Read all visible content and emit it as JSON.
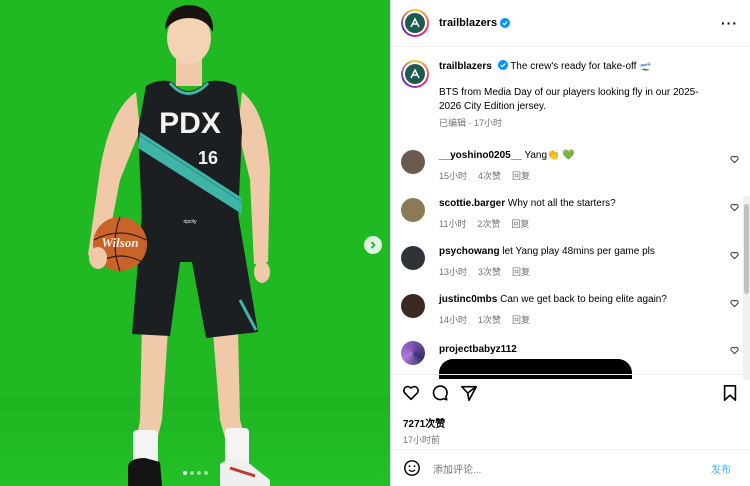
{
  "post": {
    "username": "trailblazers",
    "header_icon": "more-horizontal-icon"
  },
  "caption": {
    "username": "trailblazers",
    "title": "The crew's ready for take-off 🛫",
    "text": "BTS from Media Day of our players looking fly in our 2025-2026 City Edition jersey.",
    "edited": "已编辑",
    "time": "17小时"
  },
  "comments": [
    {
      "username": "__yoshino0205__",
      "text": "Yang👏 💚",
      "time": "15小时",
      "likes": "4次赞",
      "reply": "回复",
      "avatar_color": "#6b5a4e"
    },
    {
      "username": "scottie.barger",
      "text": "Why not all the starters?",
      "time": "11小时",
      "likes": "2次赞",
      "reply": "回复",
      "avatar_color": "#8a7a55"
    },
    {
      "username": "psychowang",
      "text": "let Yang play 48mins per game pls",
      "time": "13小时",
      "likes": "3次赞",
      "reply": "回复",
      "avatar_color": "#2f3338"
    },
    {
      "username": "justinc0mbs",
      "text": "Can we get back to being elite again?",
      "time": "14小时",
      "likes": "1次赞",
      "reply": "回复",
      "avatar_color": "#3a2a22"
    },
    {
      "username": "projectbabyz112",
      "text": "",
      "avatar_color": "#5a3f86"
    }
  ],
  "footer": {
    "likes_count": "7271次赞",
    "posted_time": "17小时前",
    "comment_placeholder": "添加评论...",
    "post_button": "发布"
  },
  "jersey": {
    "team_text": "PDX",
    "number": "16",
    "ball_brand": "Wilson",
    "sponsor": "ripcity"
  },
  "colors": {
    "green_screen": "#20b823",
    "jersey": "#1c1f22",
    "jersey_stripe": "#3fb5a8",
    "link_blue": "#4cb5f9",
    "verified_blue": "#0095f6"
  }
}
